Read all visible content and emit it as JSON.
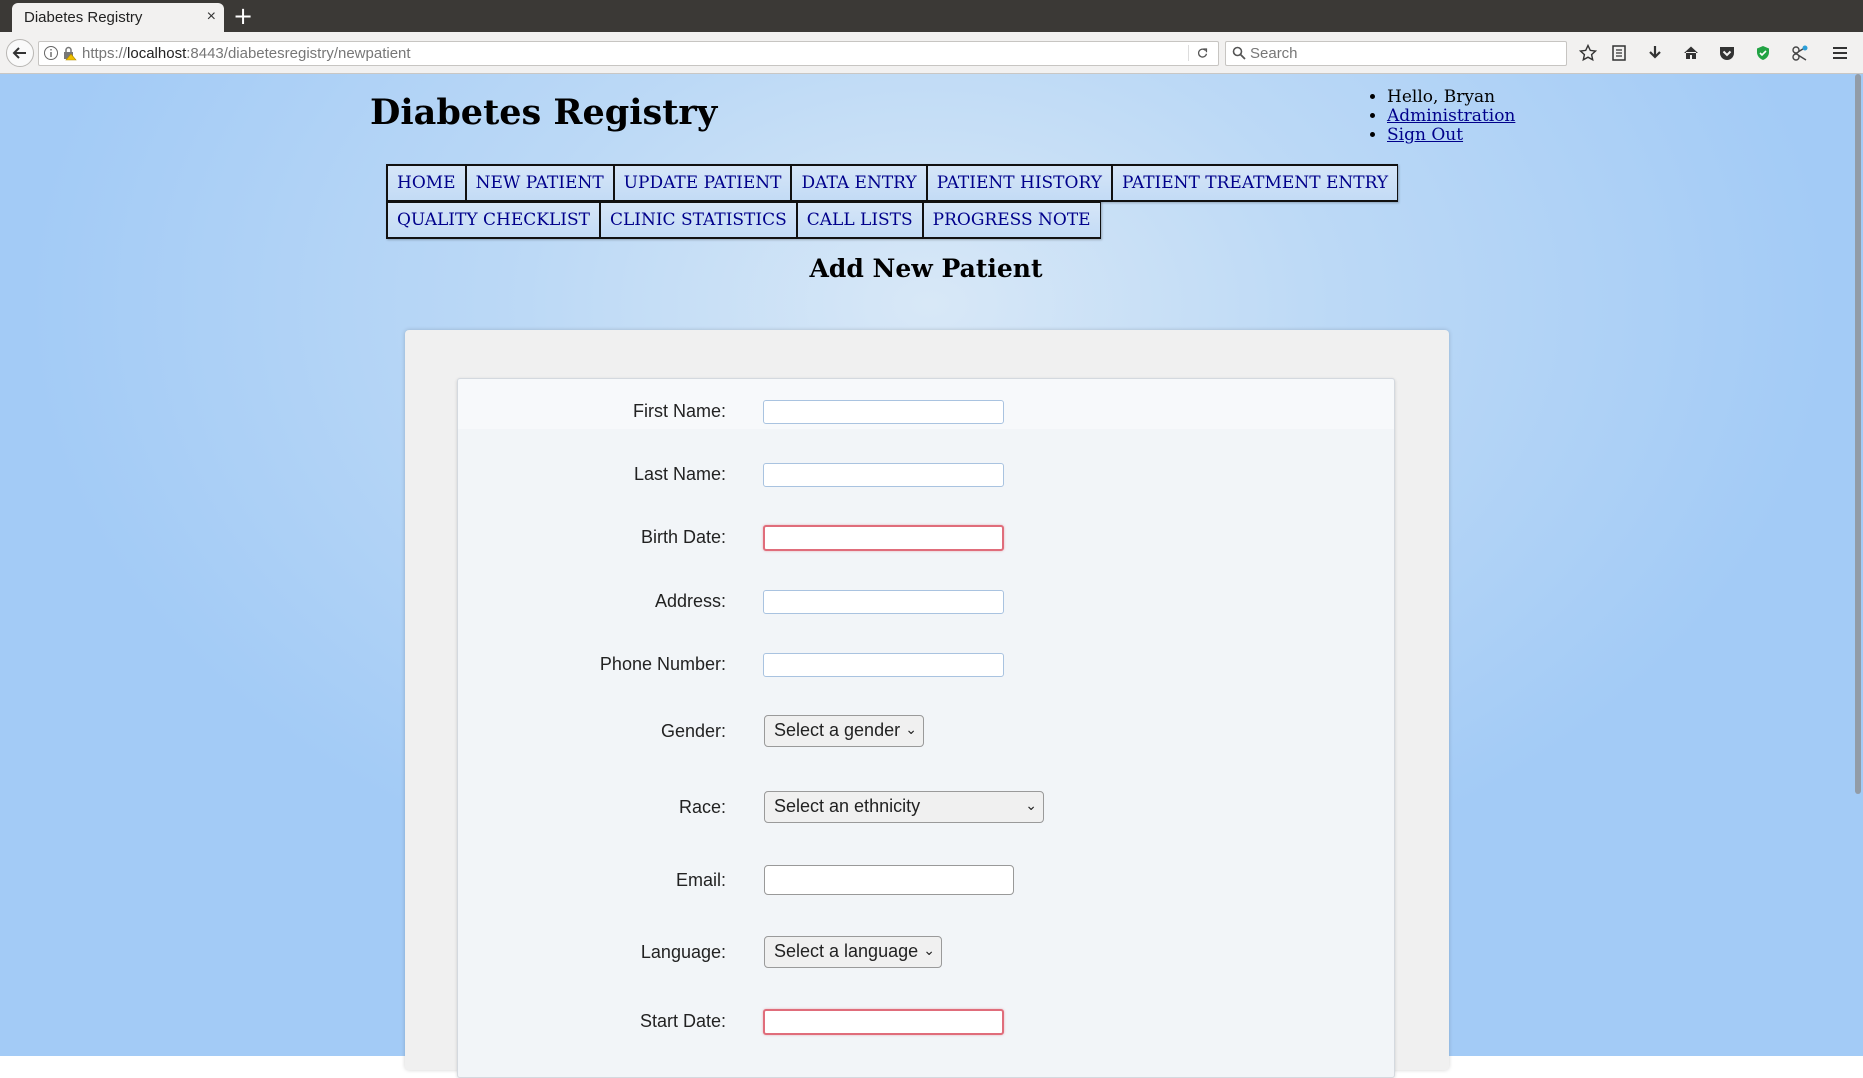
{
  "browser": {
    "tab_title": "Diabetes Registry",
    "tab_close": "×",
    "new_tab": "+",
    "url_host_prefix": "https://",
    "url_host": "localhost",
    "url_rest": ":8443/diabetesregistry/newpatient",
    "search_placeholder": "Search"
  },
  "header": {
    "site_title": "Diabetes Registry",
    "user_menu": {
      "greeting": "Hello, Bryan",
      "administration": "Administration",
      "sign_out": "Sign Out"
    }
  },
  "menu": {
    "row1": [
      "HOME",
      "NEW PATIENT",
      "UPDATE PATIENT",
      "DATA ENTRY",
      "PATIENT HISTORY",
      "PATIENT TREATMENT ENTRY"
    ],
    "row2": [
      "QUALITY CHECKLIST",
      "CLINIC STATISTICS",
      "CALL LISTS",
      "PROGRESS NOTE"
    ]
  },
  "page_heading": "Add New Patient",
  "form": {
    "first_name_label": "First Name:",
    "last_name_label": "Last Name:",
    "birth_date_label": "Birth Date:",
    "address_label": "Address:",
    "phone_label": "Phone Number:",
    "gender_label": "Gender:",
    "gender_selected": "Select a gender",
    "race_label": "Race:",
    "race_selected": "Select an ethnicity",
    "email_label": "Email:",
    "language_label": "Language:",
    "language_selected": "Select a language",
    "start_date_label": "Start Date:"
  },
  "colors": {
    "page_bg": "#a3cbf6",
    "menu_link": "#00008b",
    "invalid_border": "#e06d7b"
  }
}
